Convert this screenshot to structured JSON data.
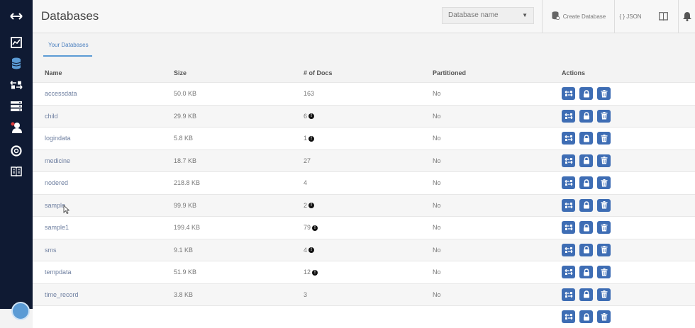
{
  "header": {
    "title": "Databases",
    "db_select_value": "Database name",
    "create_label": "Create Database",
    "json_label": "{ } JSON"
  },
  "tabs": [
    {
      "label": "Your Databases"
    }
  ],
  "table": {
    "headers": {
      "name": "Name",
      "size": "Size",
      "docs": "# of Docs",
      "partitioned": "Partitioned",
      "actions": "Actions"
    },
    "rows": [
      {
        "name": "accessdata",
        "size": "50.0 KB",
        "docs": "163",
        "partitioned": "No",
        "info": false
      },
      {
        "name": "child",
        "size": "29.9 KB",
        "docs": "6",
        "partitioned": "No",
        "info": true
      },
      {
        "name": "logindata",
        "size": "5.8 KB",
        "docs": "1",
        "partitioned": "No",
        "info": true
      },
      {
        "name": "medicine",
        "size": "18.7 KB",
        "docs": "27",
        "partitioned": "No",
        "info": false
      },
      {
        "name": "nodered",
        "size": "218.8 KB",
        "docs": "4",
        "partitioned": "No",
        "info": false
      },
      {
        "name": "sample",
        "size": "99.9 KB",
        "docs": "2",
        "partitioned": "No",
        "info": true
      },
      {
        "name": "sample1",
        "size": "199.4 KB",
        "docs": "79",
        "partitioned": "No",
        "info": true
      },
      {
        "name": "sms",
        "size": "9.1 KB",
        "docs": "4",
        "partitioned": "No",
        "info": true
      },
      {
        "name": "tempdata",
        "size": "51.9 KB",
        "docs": "12",
        "partitioned": "No",
        "info": true
      },
      {
        "name": "time_record",
        "size": "3.8 KB",
        "docs": "3",
        "partitioned": "No",
        "info": false
      },
      {
        "name": "",
        "size": "",
        "docs": "",
        "partitioned": "",
        "info": false
      }
    ]
  },
  "sidebar": {
    "icons": [
      "expand-arrows-icon",
      "activity-chart-icon",
      "database-icon",
      "replication-icon",
      "server-stack-icon",
      "user-admin-icon",
      "support-lifebuoy-icon",
      "docs-book-icon"
    ]
  },
  "colors": {
    "sidebar": "#0f1a33",
    "accent": "#3e6db4",
    "link": "#4a7fbf"
  }
}
